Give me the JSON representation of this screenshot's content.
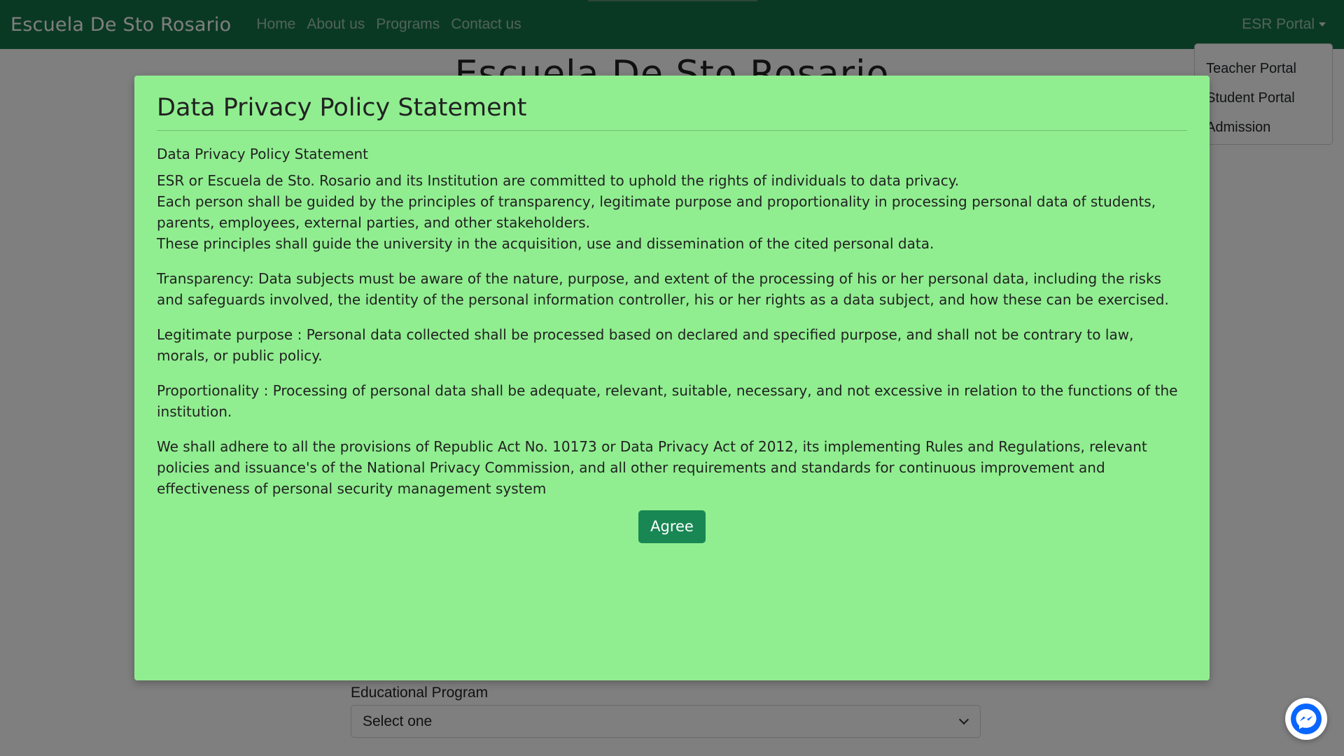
{
  "navbar": {
    "brand": "Escuela De Sto Rosario",
    "links": [
      "Home",
      "About us",
      "Programs",
      "Contact us"
    ],
    "portal_label": "ESR Portal"
  },
  "dropdown": {
    "items": [
      "Teacher Portal",
      "Student Portal",
      "Admission"
    ]
  },
  "page": {
    "heading": "Escuela De Sto Rosario",
    "program_label": "Educational Program",
    "program_select": "Select one"
  },
  "modal": {
    "title": "Data Privacy Policy Statement",
    "subtitle": "Data Privacy Policy Statement",
    "intro": [
      "ESR or Escuela de Sto. Rosario and its Institution are committed to uphold the rights of individuals to data privacy.",
      "Each person shall be guided by the principles of transparency, legitimate purpose and proportionality in processing personal data of students, parents, employees, external parties, and other stakeholders.",
      "These principles shall guide the university in the acquisition, use and dissemination of the cited personal data."
    ],
    "transparency": "Transparency: Data subjects must be aware of the nature, purpose, and extent of the processing of his or her personal data, including the risks and safeguards involved, the identity of the personal information controller, his or her rights as a data subject, and how these can be exercised.",
    "legitimate_purpose": "Legitimate purpose : Personal data collected shall be processed based on declared and specified purpose, and shall not be contrary to law, morals, or public policy.",
    "proportionality": "Proportionality : Processing of personal data shall be adequate, relevant, suitable, necessary, and not excessive in relation to the functions of the institution.",
    "adherence": "We shall adhere to all the provisions of Republic Act No. 10173 or Data Privacy Act of 2012, its implementing Rules and Regulations, relevant policies and issuance's of the National Privacy Commission, and all other requirements and standards for continuous improvement and effectiveness of personal security management system",
    "agree_label": "Agree"
  },
  "colors": {
    "navbar": "#157347",
    "modal_bg": "#90ee90",
    "agree_button": "#198754",
    "messenger": "#0866ff"
  },
  "icons": {
    "messenger": "messenger-icon",
    "dropdown_caret": "caret-down-icon",
    "select_chevron": "chevron-down-icon"
  }
}
